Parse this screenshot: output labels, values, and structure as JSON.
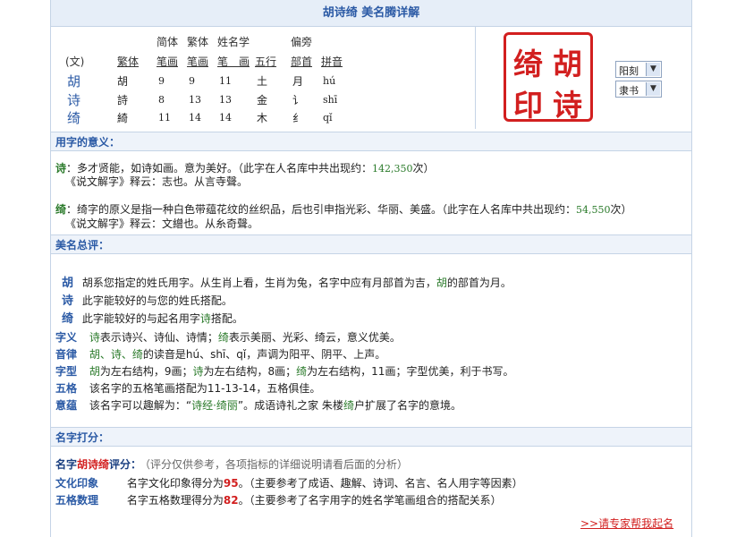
{
  "title": "胡诗绮  美名腾详解",
  "name_table": {
    "header_top": [
      "简体",
      "繁体",
      "姓名学",
      "偏旁"
    ],
    "header_bottom": [
      "(文)",
      "繁体",
      "笔画",
      "笔画",
      "笔　画",
      "五行",
      "部首",
      "拼音"
    ],
    "rows": [
      {
        "char": "胡",
        "trad": "胡",
        "simp_strokes": "9",
        "trad_strokes": "9",
        "name_strokes": "11",
        "wuxing": "土",
        "radical": "月",
        "pinyin": "hú"
      },
      {
        "char": "诗",
        "trad": "詩",
        "simp_strokes": "8",
        "trad_strokes": "13",
        "name_strokes": "13",
        "wuxing": "金",
        "radical": "讠",
        "pinyin": "shī"
      },
      {
        "char": "绮",
        "trad": "綺",
        "simp_strokes": "11",
        "trad_strokes": "14",
        "name_strokes": "14",
        "wuxing": "木",
        "radical": "纟",
        "pinyin": "qǐ"
      }
    ]
  },
  "seal": {
    "chars": [
      "胡",
      "诗",
      "绮",
      "印"
    ],
    "color": "#d21f1f"
  },
  "selects": {
    "style1": "阳刻",
    "style2": "隶书"
  },
  "meaning": {
    "heading": "用字的意义：",
    "items": [
      {
        "char": "诗",
        "text": "多才贤能，如诗如画。意为美好。（此字在人名库中共出现约：",
        "count": "142,350",
        "suffix": "次）",
        "shuowen": "《说文解字》释云：志也。从言寺聲。"
      },
      {
        "char": "绮",
        "text": "绮字的原义是指一种白色带蕴花纹的丝织品，后也引申指光彩、华丽、美盛。（此字在人名库中共出现约：",
        "count": "54,550",
        "suffix": "次）",
        "shuowen": "《说文解字》释云：文繒也。从糸奇聲。"
      }
    ]
  },
  "summary": {
    "heading": "美名总评：",
    "chars": [
      {
        "char": "胡",
        "text_pre": "胡系您指定的姓氏用字。从生肖上看，生肖为兔，名字中应有月部首为吉，",
        "hl": "胡",
        "text_post": "的部首为月。"
      },
      {
        "char": "诗",
        "text": "此字能较好的与您的姓氏搭配。"
      },
      {
        "char": "绮",
        "text_pre": "此字能较好的与起名用字",
        "hl": "诗",
        "text_post": "搭配。"
      }
    ],
    "rows": [
      {
        "label": "字义",
        "hl1": "诗",
        "t1": "表示诗兴、诗仙、诗情；",
        "hl2": "绮",
        "t2": "表示美丽、光彩、绮云，意义优美。"
      },
      {
        "label": "音律",
        "hl1": "胡、诗、绮",
        "t1": "的读音是hú、shī、qǐ，声调为阳平、阴平、上声。"
      },
      {
        "label": "字型",
        "hl1": "胡",
        "t1": "为左右结构，9画；",
        "hl2": "诗",
        "t2": "为左右结构，8画；",
        "hl3": "绮",
        "t3": "为左右结构，11画；字型优美，利于书写。"
      },
      {
        "label": "五格",
        "t1": "该名字的五格笔画搭配为11-13-14，五格俱佳。"
      },
      {
        "label": "意蕴",
        "t1": "该名字可以趣解为：“",
        "hl1": "诗经·绮丽",
        "t2": "”。成语诗礼之家  朱楼",
        "hl2": "绮",
        "t3": "户扩展了名字的意境。"
      }
    ]
  },
  "score": {
    "heading": "名字打分：",
    "intro_pre": "名字",
    "intro_name": "胡诗绮",
    "intro_post": "评分：",
    "note": "（评分仅供参考，各项指标的详细说明请看后面的分析）",
    "rows": [
      {
        "label": "文化印象",
        "pre": "名字文化印象得分为",
        "score": "95",
        "post": "。（主要参考了成语、趣解、诗词、名言、名人用字等因素）"
      },
      {
        "label": "五格数理",
        "pre": "名字五格数理得分为",
        "score": "82",
        "post": "。（主要参考了名字用字的姓名学笔画组合的搭配关系）"
      }
    ],
    "link": ">>请专家帮我起名"
  }
}
